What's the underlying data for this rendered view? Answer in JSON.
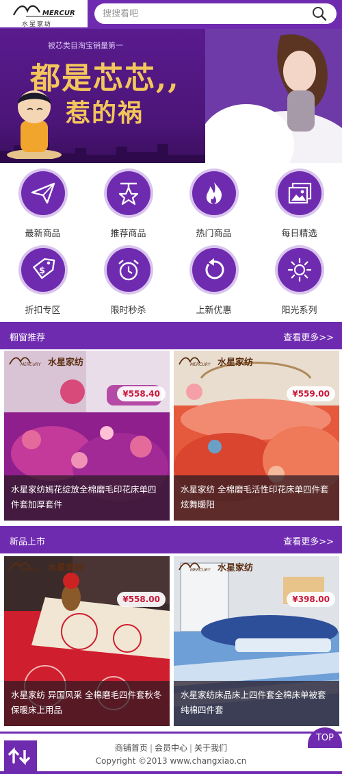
{
  "header": {
    "logo_sub": "水星家纺",
    "search_placeholder": "搜搜看吧"
  },
  "banner": {
    "topline": "被芯类目淘宝销量第一",
    "headline1": "都是芯芯,,",
    "headline2": "惹的祸",
    "slides": 3,
    "active_slide": 2
  },
  "categories": [
    {
      "label": "最新商品",
      "icon": "paper-plane-icon"
    },
    {
      "label": "推荐商品",
      "icon": "star-hanger-icon"
    },
    {
      "label": "热门商品",
      "icon": "flame-icon"
    },
    {
      "label": "每日精选",
      "icon": "photo-stack-icon"
    },
    {
      "label": "折扣专区",
      "icon": "price-tag-icon"
    },
    {
      "label": "限时秒杀",
      "icon": "alarm-clock-icon"
    },
    {
      "label": "上新优惠",
      "icon": "refresh-arrow-icon"
    },
    {
      "label": "阳光系列",
      "icon": "sun-icon"
    }
  ],
  "sections": [
    {
      "title": "橱窗推荐",
      "more": "查看更多>>",
      "products": [
        {
          "brand": "水星家纺",
          "price": "¥558.40",
          "name": "水星家纺嫣花绽放全棉磨毛印花床单四件套加厚套件"
        },
        {
          "brand": "水星家纺",
          "price": "¥559.00",
          "name": "水星家纺 全棉磨毛活性印花床单四件套炫舞暖阳"
        }
      ]
    },
    {
      "title": "新品上市",
      "more": "查看更多>>",
      "products": [
        {
          "brand": "水星家纺",
          "price": "¥558.00",
          "name": "水星家纺 异国风采 全棉磨毛四件套秋冬保暖床上用品"
        },
        {
          "brand": "水星家纺",
          "price": "¥398.00",
          "name": "水星家纺床品床上四件套全棉床单被套纯棉四件套"
        }
      ]
    }
  ],
  "footer": {
    "links": [
      "商铺首页",
      "会员中心",
      "关于我们"
    ],
    "copyright": "Copyright ©2013 www.changxiao.cn",
    "top_label": "TOP"
  },
  "colors": {
    "brand_purple": "#6f2bb0",
    "price_red": "#c8173a"
  }
}
